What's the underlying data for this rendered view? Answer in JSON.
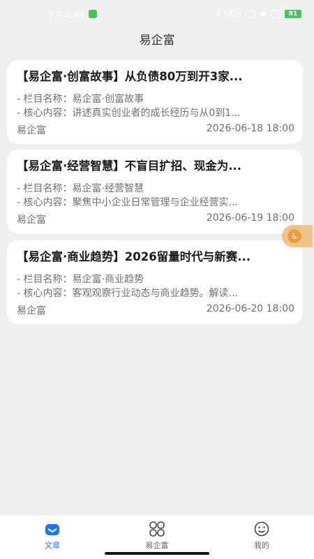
{
  "status_bar": {
    "time": "下午4:44",
    "network_speed": "3.5K/s",
    "battery": "81"
  },
  "app": {
    "title": "易企富"
  },
  "articles": [
    {
      "title": "【易企富·创富故事】从负债80万到开3家...",
      "column_label": "- 栏目名称：",
      "column_value": "易企富·创富故事",
      "content_label": "- 核心内容：",
      "content_value": "讲述真实创业者的成长经历与从0到1...",
      "author": "易企富",
      "date": "2026-06-18 18:00"
    },
    {
      "title": "【易企富·经营智慧】不盲目扩招、现金为...",
      "column_label": "- 栏目名称：",
      "column_value": "易企富·经营智慧",
      "content_label": "- 核心内容：",
      "content_value": "聚焦中小企业日常管理与企业经营实...",
      "author": "易企富",
      "date": "2026-06-19 18:00"
    },
    {
      "title": "【易企富·商业趋势】2026留量时代与新赛...",
      "column_label": "- 栏目名称：",
      "column_value": "易企富·商业趋势",
      "content_label": "- 核心内容：",
      "content_value": "客观观察行业动态与商业趋势。解读...",
      "author": "易企富",
      "date": "2026-06-20 18:00"
    }
  ],
  "tabs": [
    {
      "label": "文章",
      "icon": "article-icon",
      "active": true
    },
    {
      "label": "易企富",
      "icon": "grid-icon",
      "active": false
    },
    {
      "label": "我的",
      "icon": "smile-icon",
      "active": false
    }
  ],
  "colors": {
    "accent": "#1f78ff",
    "float": "#f39a3b"
  }
}
